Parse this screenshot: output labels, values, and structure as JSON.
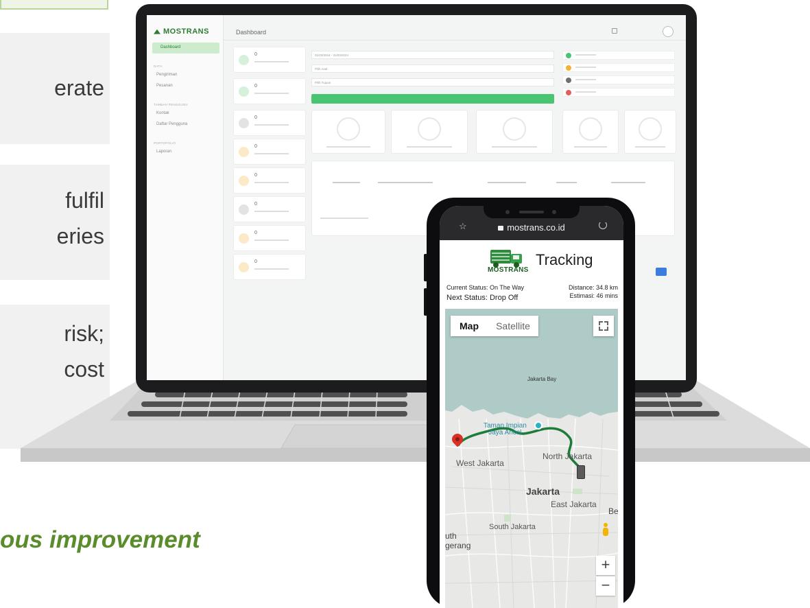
{
  "slide": {
    "cards": [
      {
        "lines": [
          "erate"
        ]
      },
      {
        "lines": [
          "fulfil",
          "eries"
        ]
      },
      {
        "lines": [
          "risk;",
          "cost"
        ]
      }
    ],
    "tagline": "ous improvement"
  },
  "dashboard": {
    "brand": "MOSTRANS",
    "page_title": "Dashboard",
    "nav_active": "Dashboard",
    "sections": [
      "DATA",
      "TAMBAH PENGGUNA",
      "PORTOFOLIO"
    ],
    "nav_items": [
      "Pengiriman",
      "Pesanan",
      "Kontak",
      "Daftar Pengguna",
      "Laporan"
    ],
    "stat_values": [
      "0",
      "0",
      "0",
      "0",
      "0",
      "0",
      "0",
      "0"
    ],
    "date_range": "01/03/2024 - 31/03/2024",
    "origin_placeholder": "Pilih Asal",
    "destination_placeholder": "Pilih Tujuan",
    "legend_colors": [
      "#49c571",
      "#f2b233",
      "#6f6f6f",
      "#e35d5d"
    ],
    "accent": "#49c571"
  },
  "phone": {
    "url": "mostrans.co.id",
    "app_title": "Tracking",
    "brand": "MOSTRANS",
    "current_status": "Current Status: On The Way",
    "next_status": "Next Status: Drop Off",
    "distance": "Distance: 34.8 km",
    "estimate": "Estimasi: 46 mins",
    "map_tabs": {
      "map": "Map",
      "satellite": "Satellite"
    },
    "map_labels": {
      "bay": "Jakarta Bay",
      "park_line1": "Taman Impian",
      "park_line2": "Jaya Ancol",
      "north": "North Jakarta",
      "west": "West Jakarta",
      "central": "Jakarta",
      "east": "East Jakarta",
      "south": "South Jakarta",
      "edge_b": "Be",
      "edge_uth": "uth",
      "edge_gerang": "gerang"
    },
    "route_color": "#1e7b3a",
    "pin_color": "#d93025"
  }
}
